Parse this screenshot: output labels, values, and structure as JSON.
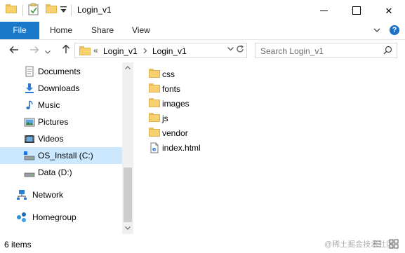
{
  "window": {
    "title": "Login_v1",
    "minimize_label": "",
    "close_label": "✕"
  },
  "ribbon": {
    "file_tab": "File",
    "tabs": [
      "Home",
      "Share",
      "View"
    ],
    "help_label": "?"
  },
  "address": {
    "overflow": "«",
    "crumbs": [
      "Login_v1",
      "Login_v1"
    ],
    "search_placeholder": "Search Login_v1"
  },
  "navpane": {
    "items": [
      {
        "label": "Documents",
        "icon": "documents-icon"
      },
      {
        "label": "Downloads",
        "icon": "downloads-icon"
      },
      {
        "label": "Music",
        "icon": "music-icon"
      },
      {
        "label": "Pictures",
        "icon": "pictures-icon"
      },
      {
        "label": "Videos",
        "icon": "videos-icon"
      },
      {
        "label": "OS_Install (C:)",
        "icon": "drive-icon",
        "selected": true
      },
      {
        "label": "Data (D:)",
        "icon": "drive-icon"
      }
    ],
    "network": "Network",
    "homegroup": "Homegroup"
  },
  "files": [
    {
      "name": "css",
      "type": "folder"
    },
    {
      "name": "fonts",
      "type": "folder"
    },
    {
      "name": "images",
      "type": "folder"
    },
    {
      "name": "js",
      "type": "folder"
    },
    {
      "name": "vendor",
      "type": "folder"
    },
    {
      "name": "index.html",
      "type": "html"
    }
  ],
  "status": {
    "count": "6 items",
    "watermark": "@稀土掘金技术社区"
  },
  "colors": {
    "accent": "#1979ca",
    "selection": "#cce8ff",
    "folder": "#f7d06f"
  }
}
